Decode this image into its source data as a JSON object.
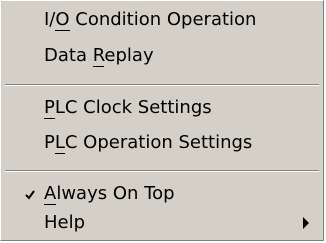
{
  "menu": {
    "items": [
      {
        "pre": "I/",
        "key": "O",
        "post": " Condition Operation"
      },
      {
        "pre": "Data ",
        "key": "R",
        "post": "eplay"
      },
      {
        "pre": "",
        "key": "P",
        "post": "LC Clock Settings"
      },
      {
        "pre": "P",
        "key": "L",
        "post": "C Operation Settings"
      },
      {
        "pre": "",
        "key": "A",
        "post": "lways On Top",
        "checked": true
      },
      {
        "pre": "Help",
        "key": "",
        "post": "",
        "submenu": true
      }
    ]
  }
}
